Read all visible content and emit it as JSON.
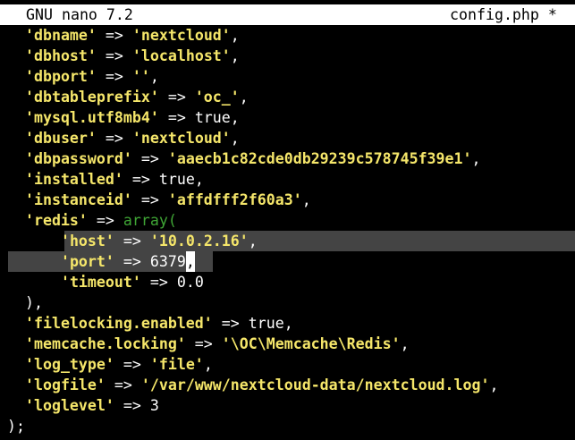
{
  "app": {
    "name": "GNU nano 7.2",
    "filename": "config.php",
    "modified_marker": "*"
  },
  "lines": [
    {
      "indent": "  ",
      "key": "'dbname'",
      "op": " => ",
      "value": "'nextcloud'",
      "tail": ","
    },
    {
      "indent": "  ",
      "key": "'dbhost'",
      "op": " => ",
      "value": "'localhost'",
      "tail": ","
    },
    {
      "indent": "  ",
      "key": "'dbport'",
      "op": " => ",
      "value": "''",
      "tail": ","
    },
    {
      "indent": "  ",
      "key": "'dbtableprefix'",
      "op": " => ",
      "value": "'oc_'",
      "tail": ","
    },
    {
      "indent": "  ",
      "key": "'mysql.utf8mb4'",
      "op": " => ",
      "value": "true",
      "tail": ","
    },
    {
      "indent": "  ",
      "key": "'dbuser'",
      "op": " => ",
      "value": "'nextcloud'",
      "tail": ","
    },
    {
      "indent": "  ",
      "key": "'dbpassword'",
      "op": " => ",
      "value": "'aaecb1c82cde0db29239c578745f39e1'",
      "tail": ","
    },
    {
      "indent": "  ",
      "key": "'installed'",
      "op": " => ",
      "value": "true",
      "tail": ","
    },
    {
      "indent": "  ",
      "key": "'instanceid'",
      "op": " => ",
      "value": "'affdfff2f60a3'",
      "tail": ","
    },
    {
      "indent": "  ",
      "key": "'redis'",
      "op": " => ",
      "value": "array(",
      "tail": ""
    },
    {
      "indent": "      ",
      "key": "'host'",
      "op": " => ",
      "value": "'10.0.2.16'",
      "tail": ","
    },
    {
      "indent": "      ",
      "key": "'port'",
      "op": " => ",
      "value": "6379",
      "tail": ","
    },
    {
      "indent": "      ",
      "key": "'timeout'",
      "op": " => ",
      "value": "0.0",
      "tail": ""
    },
    {
      "indent": "  ",
      "key": "",
      "op": "",
      "value": "",
      "tail": "),"
    },
    {
      "indent": "  ",
      "key": "'filelocking.enabled'",
      "op": " => ",
      "value": "true",
      "tail": ","
    },
    {
      "indent": "  ",
      "key": "'memcache.locking'",
      "op": " => ",
      "value": "'\\OC\\Memcache\\Redis'",
      "tail": ","
    },
    {
      "indent": "  ",
      "key": "'log_type'",
      "op": " => ",
      "value": "'file'",
      "tail": ","
    },
    {
      "indent": "  ",
      "key": "'logfile'",
      "op": " => ",
      "value": "'/var/www/nextcloud-data/nextcloud.log'",
      "tail": ","
    },
    {
      "indent": "  ",
      "key": "'loglevel'",
      "op": " => ",
      "value": "3",
      "tail": ""
    },
    {
      "indent": "",
      "key": "",
      "op": "",
      "value": "",
      "tail": ");"
    }
  ],
  "colors": {
    "background": "#000000",
    "text": "#ffffff",
    "string": "#f5e66a",
    "function": "#3fa535",
    "selection": "#444444",
    "titlebar": "#ffffff"
  }
}
